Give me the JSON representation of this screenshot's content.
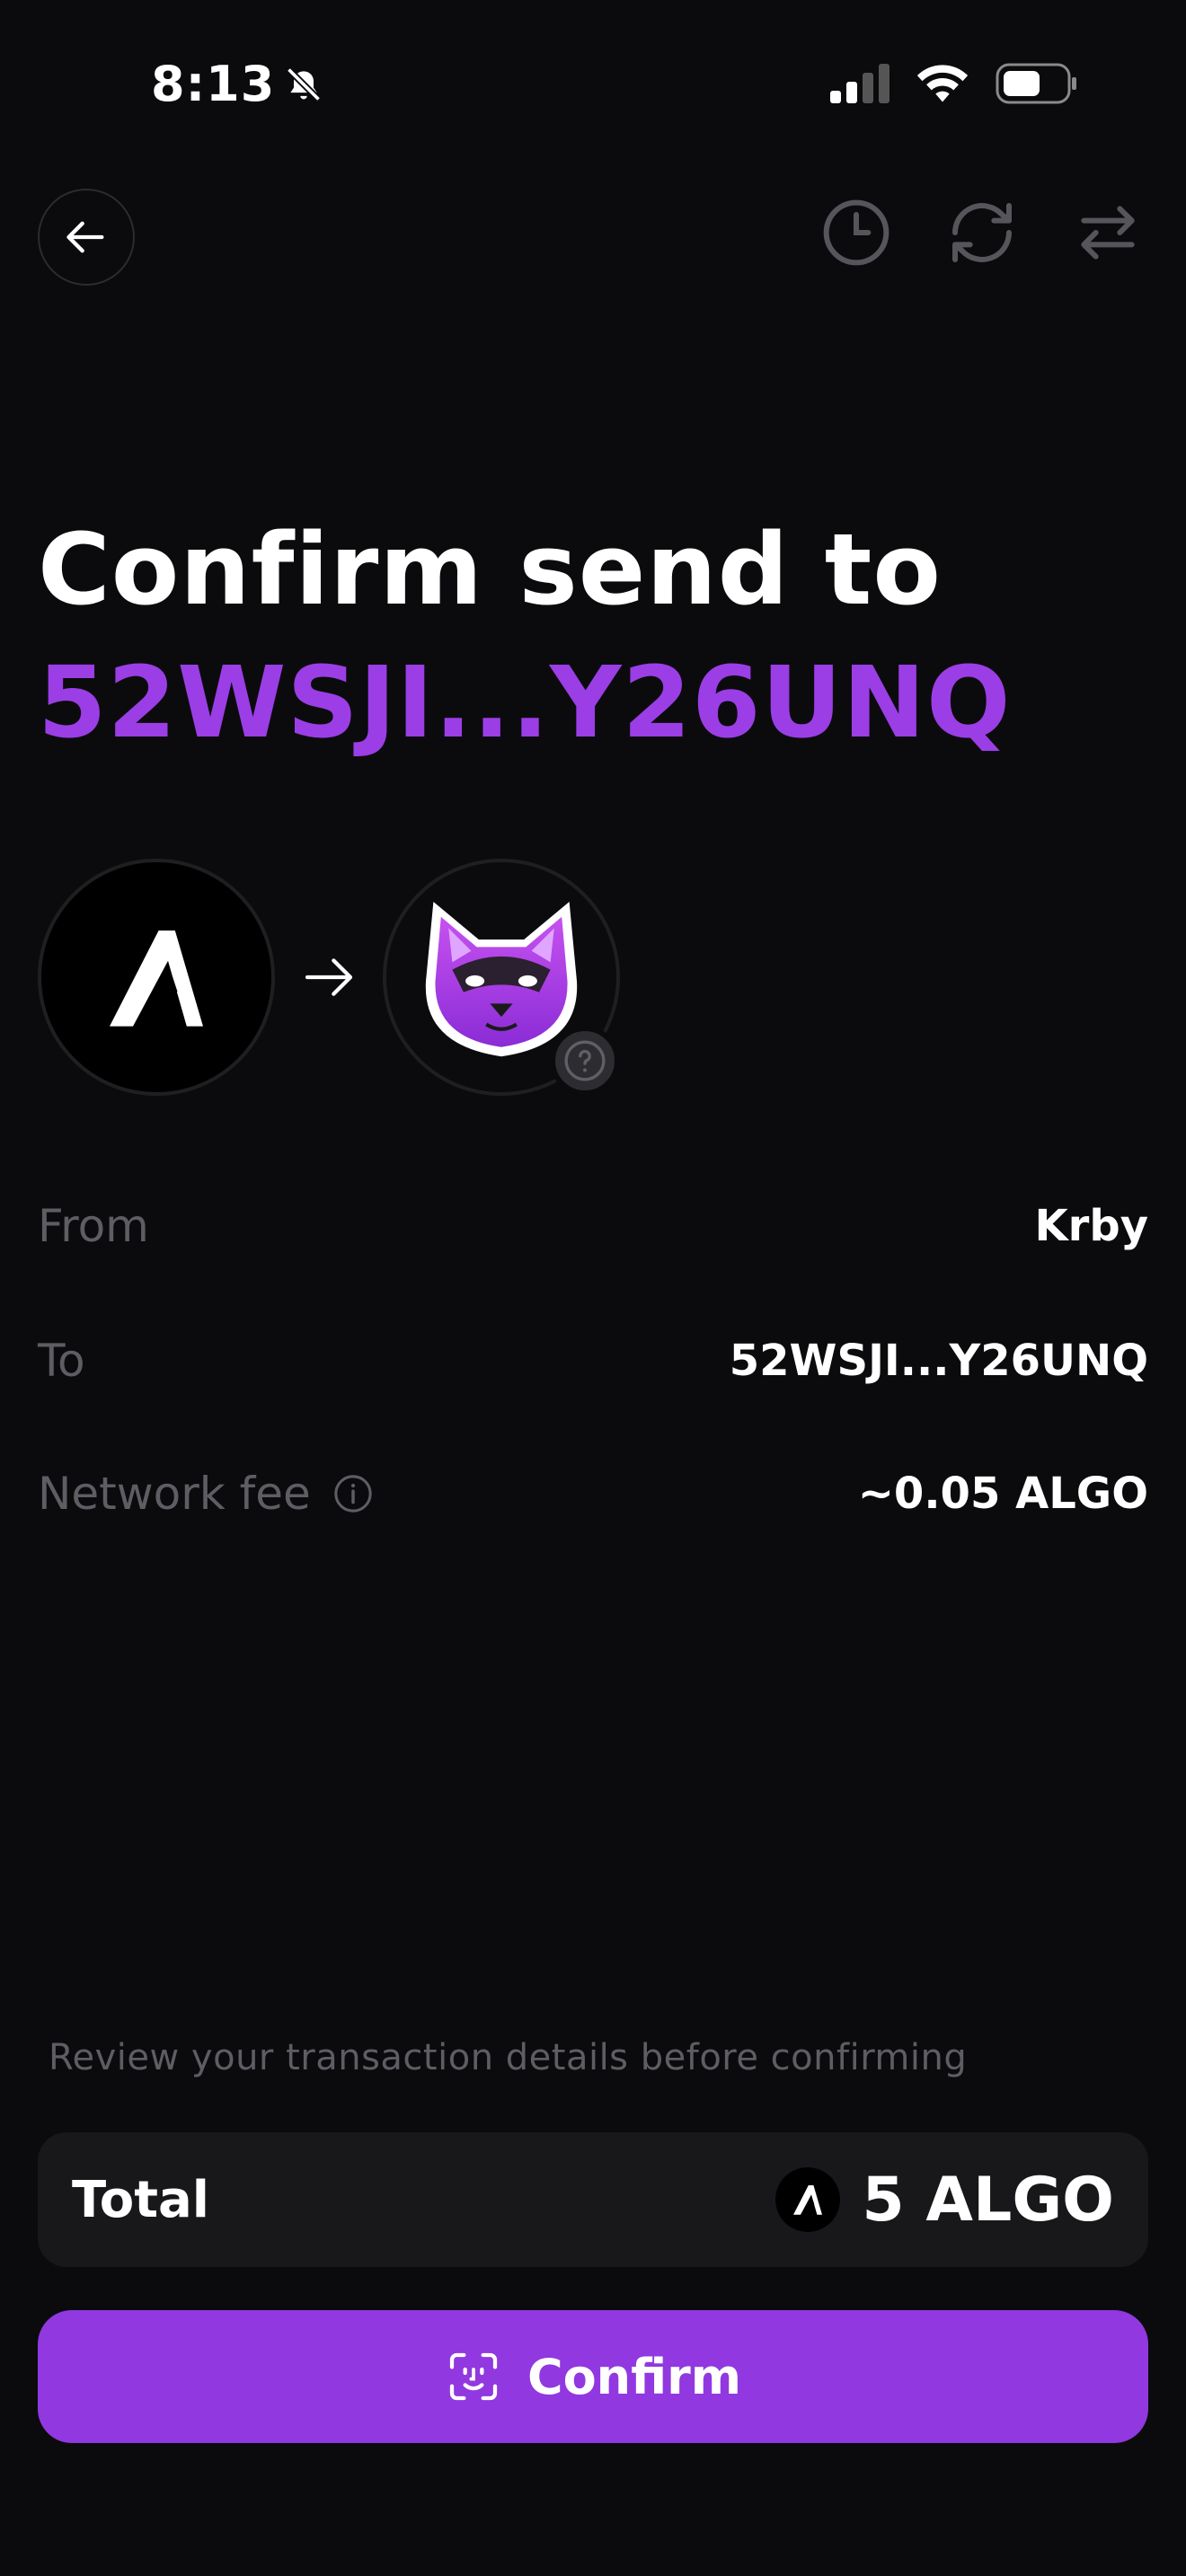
{
  "status_bar": {
    "time": "8:13",
    "icons": [
      "bell-slash-icon",
      "signal-icon",
      "wifi-icon",
      "battery-icon"
    ]
  },
  "nav": {
    "icons": [
      "back-arrow-icon",
      "history-clock-icon",
      "refresh-icon",
      "swap-arrows-icon"
    ]
  },
  "header": {
    "line1": "Confirm send to",
    "address": "52WSJI...Y26UNQ",
    "accent_color": "#9b3ee6"
  },
  "details": {
    "from_label": "From",
    "from_value": "Krby",
    "to_label": "To",
    "to_value": "52WSJI...Y26UNQ",
    "fee_label": "Network fee",
    "fee_value": "~0.05 ALGO"
  },
  "hint": "Review your transaction details before confirming",
  "total": {
    "label": "Total",
    "amount": "5 ALGO",
    "coin_icon": "algorand-icon"
  },
  "confirm_button": {
    "label": "Confirm",
    "icon": "face-id-icon",
    "color": "#9138e0"
  }
}
